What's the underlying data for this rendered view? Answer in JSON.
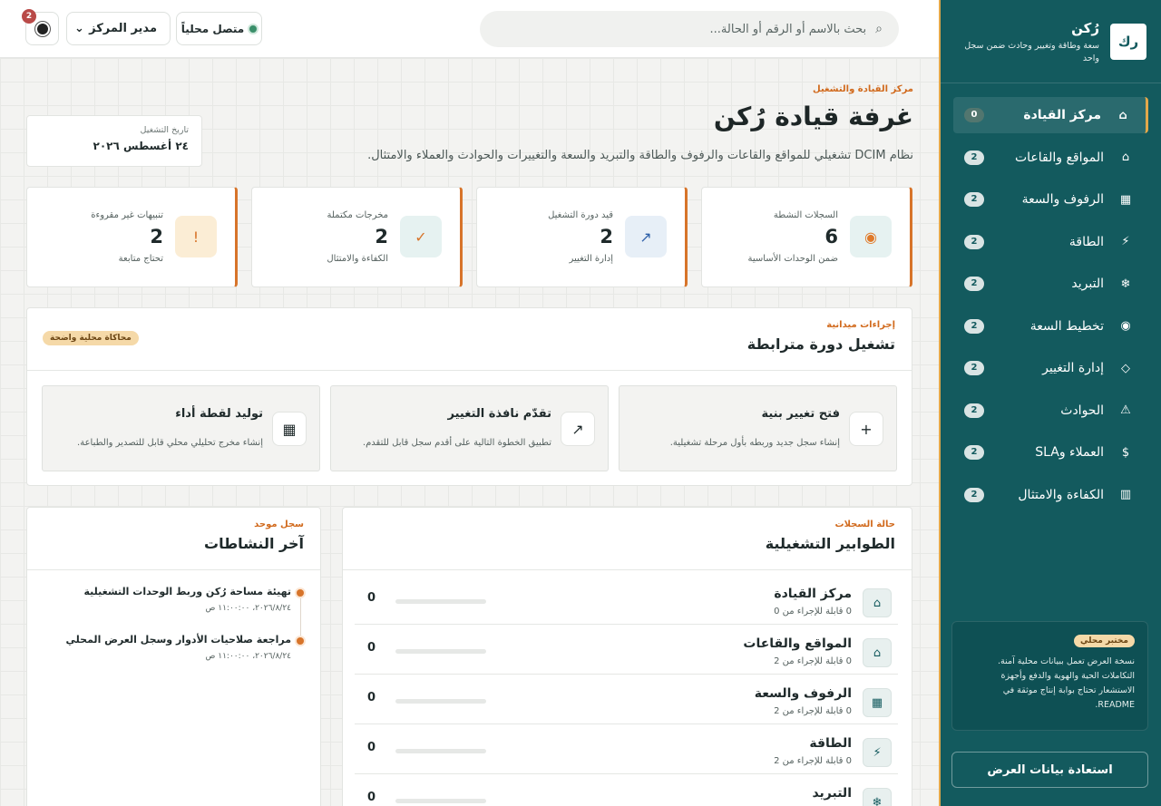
{
  "sidebar": {
    "logo_text": "رك",
    "app_name": "رُكن",
    "app_tagline": "سعة وطاقة وتغيير وحادث ضمن سجل واحد",
    "items": [
      {
        "label": "مركز القيادة",
        "icon": "⌂",
        "icon_name": "home-icon",
        "count": "0",
        "active": true
      },
      {
        "label": "المواقع والقاعات",
        "icon": "⌂",
        "icon_name": "building-icon",
        "count": "2"
      },
      {
        "label": "الرفوف والسعة",
        "icon": "▦",
        "icon_name": "rack-icon",
        "count": "2"
      },
      {
        "label": "الطاقة",
        "icon": "⚡",
        "icon_name": "lightning-icon",
        "count": "2"
      },
      {
        "label": "التبريد",
        "icon": "❄",
        "icon_name": "snowflake-icon",
        "count": "2"
      },
      {
        "label": "تخطيط السعة",
        "icon": "◉",
        "icon_name": "target-icon",
        "count": "2"
      },
      {
        "label": "إدارة التغيير",
        "icon": "◇",
        "icon_name": "diamond-icon",
        "count": "2"
      },
      {
        "label": "الحوادث",
        "icon": "⚠",
        "icon_name": "warning-icon",
        "count": "2"
      },
      {
        "label": "العملاء وSLA",
        "icon": "$",
        "icon_name": "dollar-icon",
        "count": "2"
      },
      {
        "label": "الكفاءة والامتثال",
        "icon": "▥",
        "icon_name": "chart-icon",
        "count": "2"
      }
    ],
    "lab_badge": "مختبر محلي",
    "lab_text": "نسخة العرض تعمل ببيانات محلية آمنة. التكاملات الحية والهوية والدفع وأجهزة الاستشعار تحتاج بوابة إنتاج موثقة في README.",
    "restore_label": "استعادة بيانات العرض"
  },
  "topbar": {
    "search_placeholder": "بحث بالاسم أو الرقم أو الحالة...",
    "connection_label": "متصل محلياً",
    "role_label": "مدير المركز",
    "notification_count": "2"
  },
  "hero": {
    "eyebrow": "مركز القيادة والتشغيل",
    "title": "غرفة قيادة رُكن",
    "description": "نظام DCIM تشغيلي للمواقع والقاعات والرفوف والطاقة والتبريد والسعة والتغييرات والحوادث والعملاء والامتثال.",
    "date_label": "تاريخ التشغيل",
    "date_value": "٢٤ أغسطس ٢٠٢٦"
  },
  "stats": [
    {
      "label": "السجلات النشطة",
      "value": "6",
      "sub": "ضمن الوحدات الأساسية",
      "icon": "◉",
      "icon_name": "record-icon",
      "icon_color": "#e07a2a",
      "icon_bg": "#e6f2f1"
    },
    {
      "label": "قيد دورة التشغيل",
      "value": "2",
      "sub": "إدارة التغيير",
      "icon": "↗",
      "icon_name": "arrow-up-right-icon",
      "icon_color": "#2d5fa8",
      "icon_bg": "#e7eff7"
    },
    {
      "label": "مخرجات مكتملة",
      "value": "2",
      "sub": "الكفاءة والامتثال",
      "icon": "✓",
      "icon_name": "check-icon",
      "icon_color": "#d7742a",
      "icon_bg": "#e6f2f1"
    },
    {
      "label": "تنبيهات غير مقروءة",
      "value": "2",
      "sub": "تحتاج متابعة",
      "icon": "!",
      "icon_name": "alert-icon",
      "icon_color": "#d7742a",
      "icon_bg": "#fbedd5"
    }
  ],
  "field_actions": {
    "eyebrow": "إجراءات ميدانية",
    "title": "تشغيل دورة مترابطة",
    "badge": "محاكاة محلية واضحة",
    "items": [
      {
        "title": "فتح تغيير بنية",
        "desc": "إنشاء سجل جديد وربطه بأول مرحلة تشغيلية.",
        "icon": "+",
        "icon_name": "plus-icon"
      },
      {
        "title": "تقدّم نافذة التغيير",
        "desc": "تطبيق الخطوة التالية على أقدم سجل قابل للتقدم.",
        "icon": "↗",
        "icon_name": "arrow-up-right-icon"
      },
      {
        "title": "توليد لقطة أداء",
        "desc": "إنشاء مخرج تحليلي محلي قابل للتصدير والطباعة.",
        "icon": "▦",
        "icon_name": "report-icon"
      }
    ]
  },
  "queues": {
    "eyebrow": "حالة السجلات",
    "title": "الطوابير التشغيلية",
    "items": [
      {
        "name": "مركز القيادة",
        "sub": "0 قابلة للإجراء من 0",
        "value": "0",
        "progress": 0,
        "icon": "⌂",
        "icon_name": "home-icon"
      },
      {
        "name": "المواقع والقاعات",
        "sub": "0 قابلة للإجراء من 2",
        "value": "0",
        "progress": 0,
        "icon": "⌂",
        "icon_name": "building-icon"
      },
      {
        "name": "الرفوف والسعة",
        "sub": "0 قابلة للإجراء من 2",
        "value": "0",
        "progress": 0,
        "icon": "▦",
        "icon_name": "rack-icon"
      },
      {
        "name": "الطاقة",
        "sub": "0 قابلة للإجراء من 2",
        "value": "0",
        "progress": 0,
        "icon": "⚡",
        "icon_name": "lightning-icon"
      },
      {
        "name": "التبريد",
        "sub": "",
        "value": "0",
        "progress": 0,
        "icon": "❄",
        "icon_name": "snowflake-icon"
      }
    ]
  },
  "activity": {
    "eyebrow": "سجل موحد",
    "title": "آخر النشاطات",
    "items": [
      {
        "title": "تهيئة مساحة رُكن وربط الوحدات التشغيلية",
        "time": "٢٠٢٦/٨/٢٤، ١١:٠٠:٠٠ ص"
      },
      {
        "title": "مراجعة صلاحيات الأدوار وسجل العرض المحلي",
        "time": "٢٠٢٦/٨/٢٤، ١١:٠٠:٠٠ ص"
      }
    ]
  }
}
